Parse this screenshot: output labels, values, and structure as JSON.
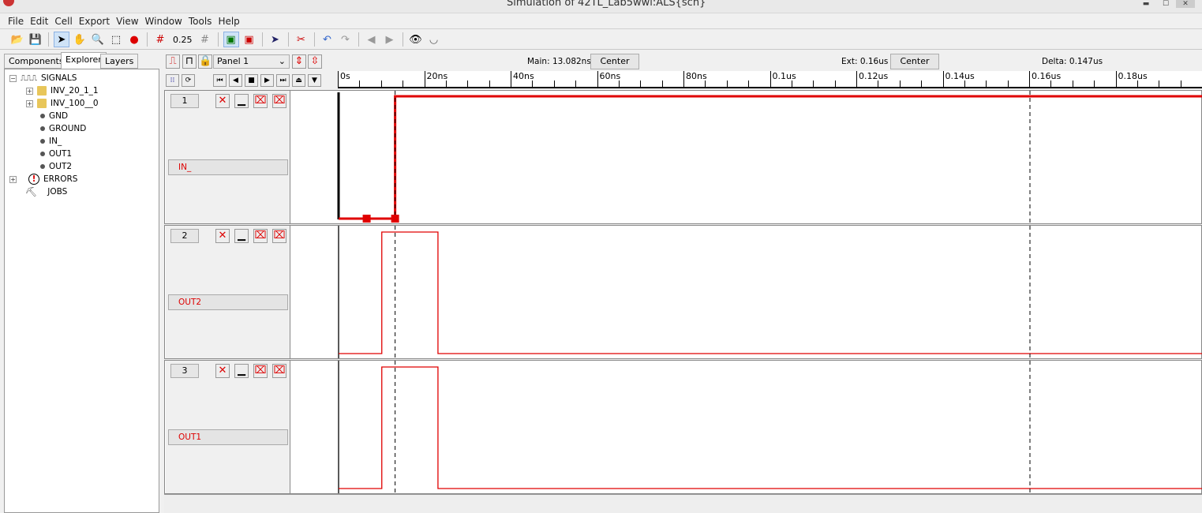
{
  "window": {
    "title": "Simulation of 42TL_Lab5wwl:ALS{sch}"
  },
  "menu": [
    "File",
    "Edit",
    "Cell",
    "Export",
    "View",
    "Window",
    "Tools",
    "Help"
  ],
  "toolbar": {
    "grid_value": "0.25"
  },
  "left_tabs": [
    "Components",
    "Explorer",
    "Layers"
  ],
  "tree": {
    "root": "SIGNALS",
    "items": [
      "INV_20_1_1",
      "INV_100__0",
      "GND",
      "GROUND",
      "IN_",
      "OUT1",
      "OUT2"
    ],
    "errors": "ERRORS",
    "jobs": "JOBS"
  },
  "header": {
    "panel_select": "Panel 1",
    "main_label": "Main: 13.082ns",
    "ext_label": "Ext: 0.16us",
    "delta_label": "Delta: 0.147us",
    "center_label": "Center"
  },
  "ruler": {
    "labels": [
      "0s",
      "20ns",
      "40ns",
      "60ns",
      "80ns",
      "0.1us",
      "0.12us",
      "0.14us",
      "0.16us",
      "0.18us"
    ]
  },
  "cursors": {
    "main_ns": 13.082,
    "ext_ns": 160
  },
  "panels": [
    {
      "number": "1",
      "signal": "IN_",
      "transitions": [
        [
          0,
          0
        ],
        [
          13.082,
          1
        ]
      ],
      "color": "#e00000",
      "highlighted": true
    },
    {
      "number": "2",
      "signal": "OUT2",
      "transitions": [
        [
          0,
          0
        ],
        [
          10,
          1
        ],
        [
          23,
          0
        ]
      ],
      "color": "#e00000",
      "highlighted": false
    },
    {
      "number": "3",
      "signal": "OUT1",
      "transitions": [
        [
          0,
          0
        ],
        [
          10,
          1
        ],
        [
          23,
          0
        ]
      ],
      "color": "#e00000",
      "highlighted": false
    }
  ],
  "time_range_ns": [
    0,
    200
  ]
}
